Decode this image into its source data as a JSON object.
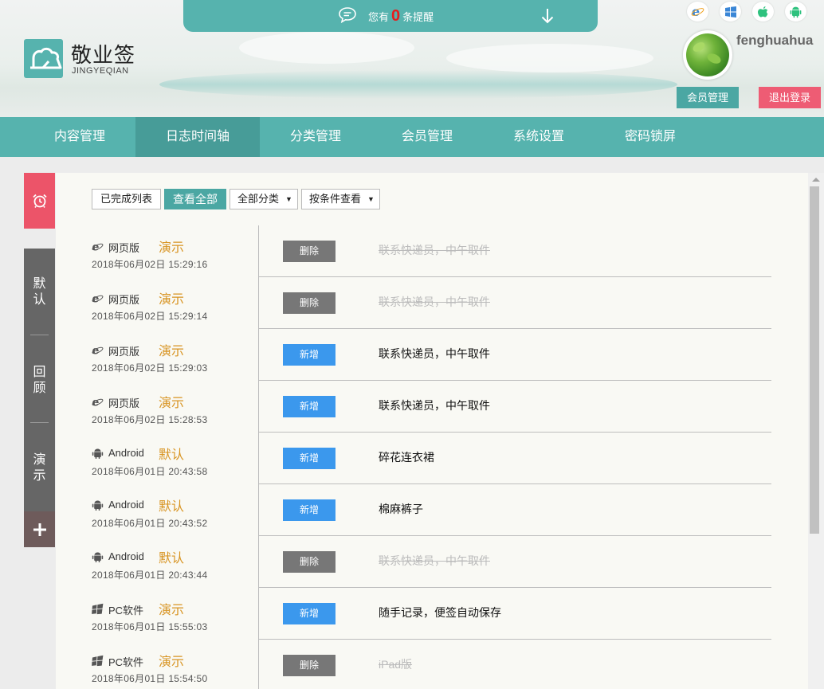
{
  "header": {
    "notice": {
      "prefix": "您有",
      "count": "0",
      "suffix": "条提醒"
    },
    "logo": {
      "name": "敬业签",
      "sub": "JINGYEQIAN"
    },
    "platform_icons": [
      "ie-icon",
      "windows-icon",
      "apple-icon",
      "android-icon"
    ],
    "username": "fenghuahua",
    "member_button": "会员管理",
    "logout_button": "退出登录"
  },
  "nav": {
    "items": [
      {
        "label": "内容管理",
        "active": false
      },
      {
        "label": "日志时间轴",
        "active": true
      },
      {
        "label": "分类管理",
        "active": false
      },
      {
        "label": "会员管理",
        "active": false
      },
      {
        "label": "系统设置",
        "active": false
      },
      {
        "label": "密码锁屏",
        "active": false
      }
    ]
  },
  "sidebar": {
    "alarm_icon": "alarm-clock-icon",
    "tabs": [
      {
        "line1": "默",
        "line2": "认"
      },
      {
        "line1": "回",
        "line2": "顾"
      },
      {
        "line1": "演",
        "line2": "示"
      }
    ],
    "add_icon": "plus-icon"
  },
  "toolbar": {
    "completed_list": "已完成列表",
    "view_all": "查看全部",
    "category_select": "全部分类",
    "condition_select": "按条件查看"
  },
  "logs": [
    {
      "platform": "web",
      "source": "网页版",
      "category": "演示",
      "time": "2018年06月02日 15:29:16",
      "action": "删除",
      "action_type": "del",
      "content": "联系快递员，中午取件",
      "done": true
    },
    {
      "platform": "web",
      "source": "网页版",
      "category": "演示",
      "time": "2018年06月02日 15:29:14",
      "action": "删除",
      "action_type": "del",
      "content": "联系快递员，中午取件",
      "done": true
    },
    {
      "platform": "web",
      "source": "网页版",
      "category": "演示",
      "time": "2018年06月02日 15:29:03",
      "action": "新增",
      "action_type": "add",
      "content": "联系快递员，中午取件",
      "done": false
    },
    {
      "platform": "web",
      "source": "网页版",
      "category": "演示",
      "time": "2018年06月02日 15:28:53",
      "action": "新增",
      "action_type": "add",
      "content": "联系快递员，中午取件",
      "done": false
    },
    {
      "platform": "android",
      "source": "Android",
      "category": "默认",
      "time": "2018年06月01日 20:43:58",
      "action": "新增",
      "action_type": "add",
      "content": "碎花连衣裙",
      "done": false
    },
    {
      "platform": "android",
      "source": "Android",
      "category": "默认",
      "time": "2018年06月01日 20:43:52",
      "action": "新增",
      "action_type": "add",
      "content": "棉麻裤子",
      "done": false
    },
    {
      "platform": "android",
      "source": "Android",
      "category": "默认",
      "time": "2018年06月01日 20:43:44",
      "action": "删除",
      "action_type": "del",
      "content": "联系快递员，中午取件",
      "done": true
    },
    {
      "platform": "pc",
      "source": "PC软件",
      "category": "演示",
      "time": "2018年06月01日 15:55:03",
      "action": "新增",
      "action_type": "add",
      "content": "随手记录，便签自动保存",
      "done": false
    },
    {
      "platform": "pc",
      "source": "PC软件",
      "category": "演示",
      "time": "2018年06月01日 15:54:50",
      "action": "删除",
      "action_type": "del",
      "content": "iPad版",
      "done": true
    }
  ],
  "colors": {
    "teal": "#56b3ae",
    "teal_dark": "#479c98",
    "pink": "#ee5c74",
    "category_orange": "#d89422",
    "add_blue": "#3b98ed",
    "del_gray": "#777777"
  }
}
